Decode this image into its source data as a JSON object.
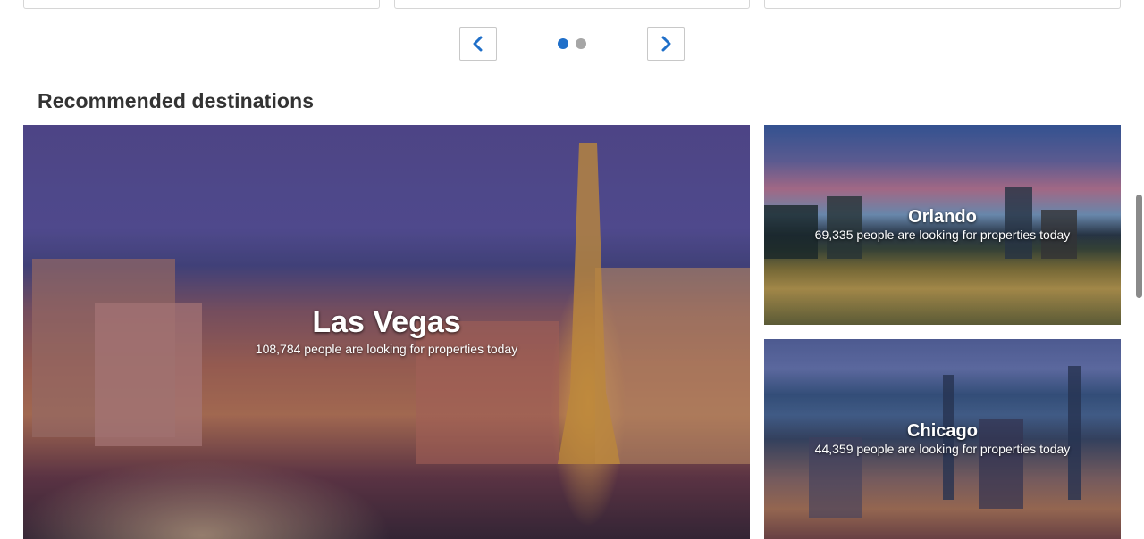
{
  "carousel": {
    "prev_icon": "chevron-left-icon",
    "next_icon": "chevron-right-icon",
    "pages": 2,
    "active_page": 1,
    "colors": {
      "active": "#1f6fc9",
      "inactive": "#a6a6a6",
      "chevron": "#1f6fc9"
    }
  },
  "section": {
    "title": "Recommended destinations"
  },
  "destinations": [
    {
      "name": "Las Vegas",
      "subtitle": "108,784 people are looking for properties today"
    },
    {
      "name": "Orlando",
      "subtitle": "69,335 people are looking for properties today"
    },
    {
      "name": "Chicago",
      "subtitle": "44,359 people are looking for properties today"
    }
  ]
}
